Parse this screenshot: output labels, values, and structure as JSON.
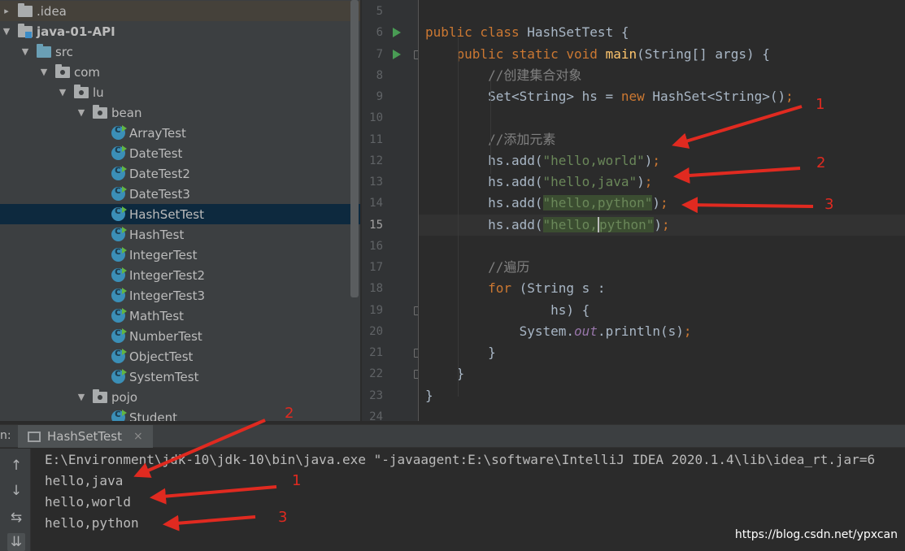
{
  "project_tree": {
    "items": [
      {
        "label": ".idea",
        "icon": "folder-icon",
        "arrow": "▸",
        "depth": 0
      },
      {
        "label": "java-01-API",
        "icon": "module-folder-icon",
        "arrow": "▼",
        "depth": 0
      },
      {
        "label": "src",
        "icon": "source-folder-icon",
        "arrow": "▼",
        "depth": 1
      },
      {
        "label": "com",
        "icon": "package-icon",
        "arrow": "▼",
        "depth": 2
      },
      {
        "label": "lu",
        "icon": "package-icon",
        "arrow": "▼",
        "depth": 3
      },
      {
        "label": "bean",
        "icon": "package-icon",
        "arrow": "▼",
        "depth": 4
      },
      {
        "label": "ArrayTest",
        "icon": "java-class-icon",
        "arrow": "",
        "depth": 5
      },
      {
        "label": "DateTest",
        "icon": "java-class-icon",
        "arrow": "",
        "depth": 5
      },
      {
        "label": "DateTest2",
        "icon": "java-class-icon",
        "arrow": "",
        "depth": 5
      },
      {
        "label": "DateTest3",
        "icon": "java-class-icon",
        "arrow": "",
        "depth": 5
      },
      {
        "label": "HashSetTest",
        "icon": "java-class-icon",
        "arrow": "",
        "depth": 5
      },
      {
        "label": "HashTest",
        "icon": "java-class-icon",
        "arrow": "",
        "depth": 5
      },
      {
        "label": "IntegerTest",
        "icon": "java-class-icon",
        "arrow": "",
        "depth": 5
      },
      {
        "label": "IntegerTest2",
        "icon": "java-class-icon",
        "arrow": "",
        "depth": 5
      },
      {
        "label": "IntegerTest3",
        "icon": "java-class-icon",
        "arrow": "",
        "depth": 5
      },
      {
        "label": "MathTest",
        "icon": "java-class-icon",
        "arrow": "",
        "depth": 5
      },
      {
        "label": "NumberTest",
        "icon": "java-class-icon",
        "arrow": "",
        "depth": 5
      },
      {
        "label": "ObjectTest",
        "icon": "java-class-icon",
        "arrow": "",
        "depth": 5
      },
      {
        "label": "SystemTest",
        "icon": "java-class-icon",
        "arrow": "",
        "depth": 5
      },
      {
        "label": "pojo",
        "icon": "package-icon",
        "arrow": "▼",
        "depth": 4
      },
      {
        "label": "Student",
        "icon": "java-class-icon",
        "arrow": "",
        "depth": 5
      }
    ],
    "selected": "HashSetTest"
  },
  "editor": {
    "line_numbers": [
      "5",
      "6",
      "7",
      "8",
      "9",
      "10",
      "11",
      "12",
      "13",
      "14",
      "15",
      "16",
      "17",
      "18",
      "19",
      "20",
      "21",
      "22",
      "23",
      "24"
    ],
    "current_line": "15",
    "lines": [
      {
        "num": "5",
        "tokens": []
      },
      {
        "num": "6",
        "tokens": [
          {
            "t": "kw",
            "v": "public class "
          },
          {
            "t": "p",
            "v": "HashSetTest {"
          }
        ]
      },
      {
        "num": "7",
        "tokens": [
          {
            "t": "p",
            "v": "    "
          },
          {
            "t": "kw",
            "v": "public static void "
          },
          {
            "t": "fn",
            "v": "main"
          },
          {
            "t": "p",
            "v": "(String[] args) {"
          }
        ]
      },
      {
        "num": "8",
        "tokens": [
          {
            "t": "p",
            "v": "        "
          },
          {
            "t": "cmt",
            "v": "//创建集合对象"
          }
        ]
      },
      {
        "num": "9",
        "tokens": [
          {
            "t": "p",
            "v": "        Set<String> hs = "
          },
          {
            "t": "kw",
            "v": "new "
          },
          {
            "t": "p",
            "v": "HashSet<String>()"
          },
          {
            "t": "kw",
            "v": ";"
          }
        ]
      },
      {
        "num": "10",
        "tokens": []
      },
      {
        "num": "11",
        "tokens": [
          {
            "t": "p",
            "v": "        "
          },
          {
            "t": "cmt",
            "v": "//添加元素"
          }
        ]
      },
      {
        "num": "12",
        "tokens": [
          {
            "t": "p",
            "v": "        hs.add("
          },
          {
            "t": "str",
            "v": "\"hello,world\""
          },
          {
            "t": "p",
            "v": ")"
          },
          {
            "t": "kw",
            "v": ";"
          }
        ]
      },
      {
        "num": "13",
        "tokens": [
          {
            "t": "p",
            "v": "        hs.add("
          },
          {
            "t": "str",
            "v": "\"hello,java\""
          },
          {
            "t": "p",
            "v": ")"
          },
          {
            "t": "kw",
            "v": ";"
          }
        ]
      },
      {
        "num": "14",
        "tokens": [
          {
            "t": "p",
            "v": "        hs.add("
          },
          {
            "t": "strhl",
            "v": "\"hello,python\""
          },
          {
            "t": "p",
            "v": ")"
          },
          {
            "t": "kw",
            "v": ";"
          }
        ]
      },
      {
        "num": "15",
        "tokens": [
          {
            "t": "p",
            "v": "        hs.add("
          },
          {
            "t": "strhl",
            "v": "\"hello,"
          },
          {
            "t": "strhlc",
            "v": "python\""
          },
          {
            "t": "p",
            "v": ")"
          },
          {
            "t": "kw",
            "v": ";"
          }
        ]
      },
      {
        "num": "16",
        "tokens": []
      },
      {
        "num": "17",
        "tokens": [
          {
            "t": "p",
            "v": "        "
          },
          {
            "t": "cmt",
            "v": "//遍历"
          }
        ]
      },
      {
        "num": "18",
        "tokens": [
          {
            "t": "p",
            "v": "        "
          },
          {
            "t": "kw",
            "v": "for "
          },
          {
            "t": "p",
            "v": "(String s :"
          }
        ]
      },
      {
        "num": "19",
        "tokens": [
          {
            "t": "p",
            "v": "                hs) {"
          }
        ]
      },
      {
        "num": "20",
        "tokens": [
          {
            "t": "p",
            "v": "            System."
          },
          {
            "t": "fld",
            "v": "out"
          },
          {
            "t": "p",
            "v": ".println(s)"
          },
          {
            "t": "kw",
            "v": ";"
          }
        ]
      },
      {
        "num": "21",
        "tokens": [
          {
            "t": "p",
            "v": "        }"
          }
        ]
      },
      {
        "num": "22",
        "tokens": [
          {
            "t": "p",
            "v": "    }"
          }
        ]
      },
      {
        "num": "23",
        "tokens": [
          {
            "t": "p",
            "v": "}"
          }
        ]
      },
      {
        "num": "24",
        "tokens": []
      }
    ]
  },
  "run_panel": {
    "label": "n:",
    "tab_label": "HashSetTest",
    "tab_close": "×",
    "toolbar": {
      "up": "↑",
      "down": "↓",
      "wrap": "⇆",
      "scroll_end": "⇊"
    },
    "output": [
      "E:\\Environment\\jdk-10\\jdk-10\\bin\\java.exe \"-javaagent:E:\\software\\IntelliJ IDEA 2020.1.4\\lib\\idea_rt.jar=6",
      "hello,java",
      "hello,world",
      "hello,python"
    ]
  },
  "annotations": {
    "color": "#e02a20",
    "labels": [
      "1",
      "2",
      "3",
      "2",
      "1",
      "3"
    ]
  },
  "watermark": "https://blog.csdn.net/ypxcan",
  "colors": {
    "keyword": "#cc7832",
    "function": "#ffc66d",
    "string": "#6a8759",
    "comment": "#808080",
    "field": "#9876aa",
    "text": "#a9b7c6"
  }
}
